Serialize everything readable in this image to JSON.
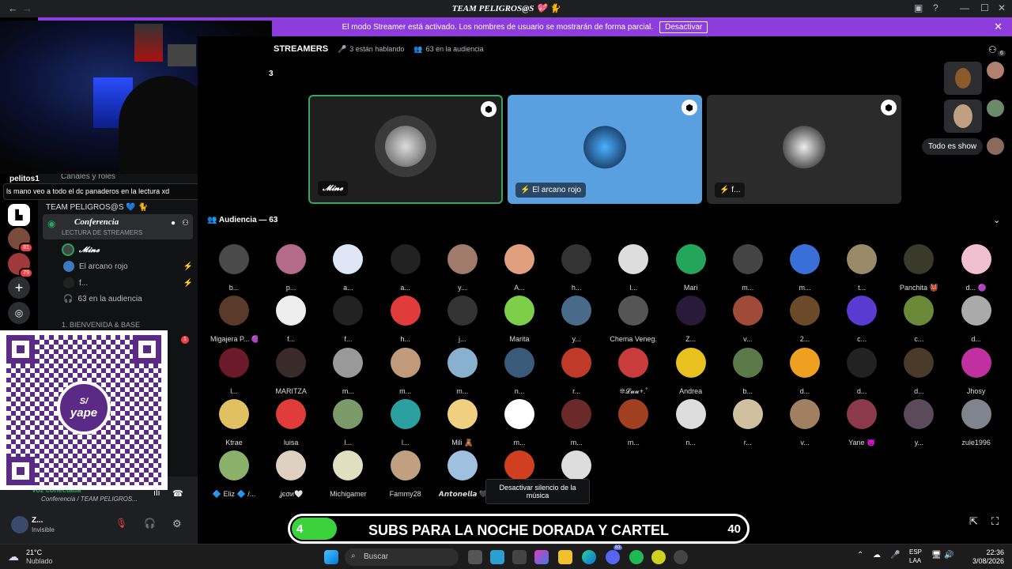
{
  "titlebar": {
    "title": "TEAM PELIGROS@S 💖 🐈"
  },
  "banner": {
    "text": "El modo Streamer está activado. Los nombres de usuario se mostrarán de forma parcial.",
    "button": "Desactivar"
  },
  "overlay": {
    "chat_user": "pelitos1",
    "chat_message": "ls mano veo a todo el dc panaderos en la lectura xd",
    "qr_brand": "yape",
    "qr_symbol": "S/"
  },
  "sidebar": {
    "channels_roles": "Canales y roles",
    "server_name": "TEAM PELIGROS@S 💙 🐈",
    "channel": "Conferencia",
    "channel_sub": "LECTURA DE STREAMERS",
    "speakers": [
      "𝓜𝓲𝓷𝓮",
      "El arcano rojo",
      "f..."
    ],
    "audience_count": "63 en la audiencia",
    "category": "1. BIENVENIDA & BASE",
    "voice_status": "Voz conectada",
    "voice_channel": "Conferencia / TEAM PELIGROS...",
    "user_name": "Z...",
    "user_status": "Invisible",
    "rail_badges": [
      "81",
      "79"
    ],
    "unread_badge": "1"
  },
  "stage": {
    "title": "STREAMERS",
    "speaking": "3 están hablando",
    "audience": "63 en la audiencia",
    "count": "3",
    "tiles": [
      {
        "label": "𝓜𝓲𝓷𝓮",
        "bg": "#1f1f1f",
        "border": "#3ba55d"
      },
      {
        "label": "El arcano rojo",
        "bg": "#5aa0e0",
        "border": "none"
      },
      {
        "label": "f...",
        "bg": "#2b2b2b",
        "border": "none"
      }
    ],
    "right_badge": "6",
    "right_chip": "Todo es show"
  },
  "audience": {
    "title": "Audiencia — 63",
    "members": [
      {
        "n": "b...",
        "c": "#4a4a4a"
      },
      {
        "n": "p...",
        "c": "#b46a8a"
      },
      {
        "n": "a...",
        "c": "#dfe6f5"
      },
      {
        "n": "a...",
        "c": "#222"
      },
      {
        "n": "y...",
        "c": "#a07a6a"
      },
      {
        "n": "A...",
        "c": "#e0a080"
      },
      {
        "n": "h...",
        "c": "#333"
      },
      {
        "n": "l...",
        "c": "#ddd"
      },
      {
        "n": "Mari",
        "c": "#23a55a"
      },
      {
        "n": "m...",
        "c": "#444"
      },
      {
        "n": "m...",
        "c": "#3a6fd8"
      },
      {
        "n": "t...",
        "c": "#9a8a6a"
      },
      {
        "n": "Panchita 👹",
        "c": "#3a3a2a"
      },
      {
        "n": "d... 🟣",
        "c": "#f0c0d0"
      },
      {
        "n": "Migajera P... 🟣",
        "c": "#5a3a2a"
      },
      {
        "n": "f...",
        "c": "#eee"
      },
      {
        "n": "f...",
        "c": "#222"
      },
      {
        "n": "h...",
        "c": "#e03c3c"
      },
      {
        "n": "j...",
        "c": "#333"
      },
      {
        "n": "Marita",
        "c": "#7dcf4a"
      },
      {
        "n": "y...",
        "c": "#4a6a8a"
      },
      {
        "n": "Chema Veneg...",
        "c": "#555"
      },
      {
        "n": "Z...",
        "c": "#2a1a3a"
      },
      {
        "n": "v...",
        "c": "#a04a3a"
      },
      {
        "n": "2...",
        "c": "#6a4a2a"
      },
      {
        "n": "c...",
        "c": "#5a3ad0"
      },
      {
        "n": "c...",
        "c": "#6a8a3a"
      },
      {
        "n": "d...",
        "c": "#aaa"
      },
      {
        "n": "l...",
        "c": "#6a1a2a"
      },
      {
        "n": "MARITZA",
        "c": "#3a2a2a"
      },
      {
        "n": "m...",
        "c": "#999"
      },
      {
        "n": "m...",
        "c": "#c09a7a"
      },
      {
        "n": "m...",
        "c": "#8ab0d0"
      },
      {
        "n": "n...",
        "c": "#3a5a7a"
      },
      {
        "n": "r...",
        "c": "#c03a2a"
      },
      {
        "n": "❊𝓛𝓾𝓾+.˚",
        "c": "#c83c3c"
      },
      {
        "n": "Andrea",
        "c": "#e8c020"
      },
      {
        "n": "b...",
        "c": "#5a7a4a"
      },
      {
        "n": "d...",
        "c": "#f0a020"
      },
      {
        "n": "d...",
        "c": "#222"
      },
      {
        "n": "d...",
        "c": "#4a3a2a"
      },
      {
        "n": "Jhosy",
        "c": "#c030a0"
      },
      {
        "n": "Ktrae",
        "c": "#e0c060"
      },
      {
        "n": "luisa",
        "c": "#e03c3c"
      },
      {
        "n": "l...",
        "c": "#7a9a6a"
      },
      {
        "n": "l...",
        "c": "#2aa0a0"
      },
      {
        "n": "Mili 🧸",
        "c": "#f0d080"
      },
      {
        "n": "m...",
        "c": "#fff"
      },
      {
        "n": "m...",
        "c": "#6a2a2a"
      },
      {
        "n": "m...",
        "c": "#a04020"
      },
      {
        "n": "n...",
        "c": "#ddd"
      },
      {
        "n": "r...",
        "c": "#d0c0a0"
      },
      {
        "n": "v...",
        "c": "#a08060"
      },
      {
        "n": "Yane 👿",
        "c": "#8a3a4a"
      },
      {
        "n": "y...",
        "c": "#5a4a5a"
      },
      {
        "n": "zule1996",
        "c": "#80848e"
      },
      {
        "n": "🔷 Eliz 🔷 /...",
        "c": "#8ab06a"
      },
      {
        "n": "ʝєσи🤍",
        "c": "#e0d0c0"
      },
      {
        "n": "Michigamer",
        "c": "#e0e0c0"
      },
      {
        "n": "Fammy28",
        "c": "#c0a080"
      },
      {
        "n": "𝘼𝙣𝙩𝙤𝙣𝙚𝙡𝙡𝙖 🖤",
        "c": "#a0c0e0"
      },
      {
        "n": "",
        "c": "#d04020"
      },
      {
        "n": "...u...",
        "c": "#ddd"
      }
    ]
  },
  "tooltip": "Desactivar silencio de la música",
  "subs": {
    "text": "SUBS PARA LA NOCHE DORADA Y CARTEL",
    "current": "4",
    "goal": "40",
    "progress": 0.1
  },
  "taskbar": {
    "temp": "21°C",
    "weather": "Nublado",
    "search": "Buscar",
    "lang": "ESP",
    "lang2": "LAA",
    "time": "22:36",
    "date": "3/08/2026",
    "discord_badge": "83"
  }
}
